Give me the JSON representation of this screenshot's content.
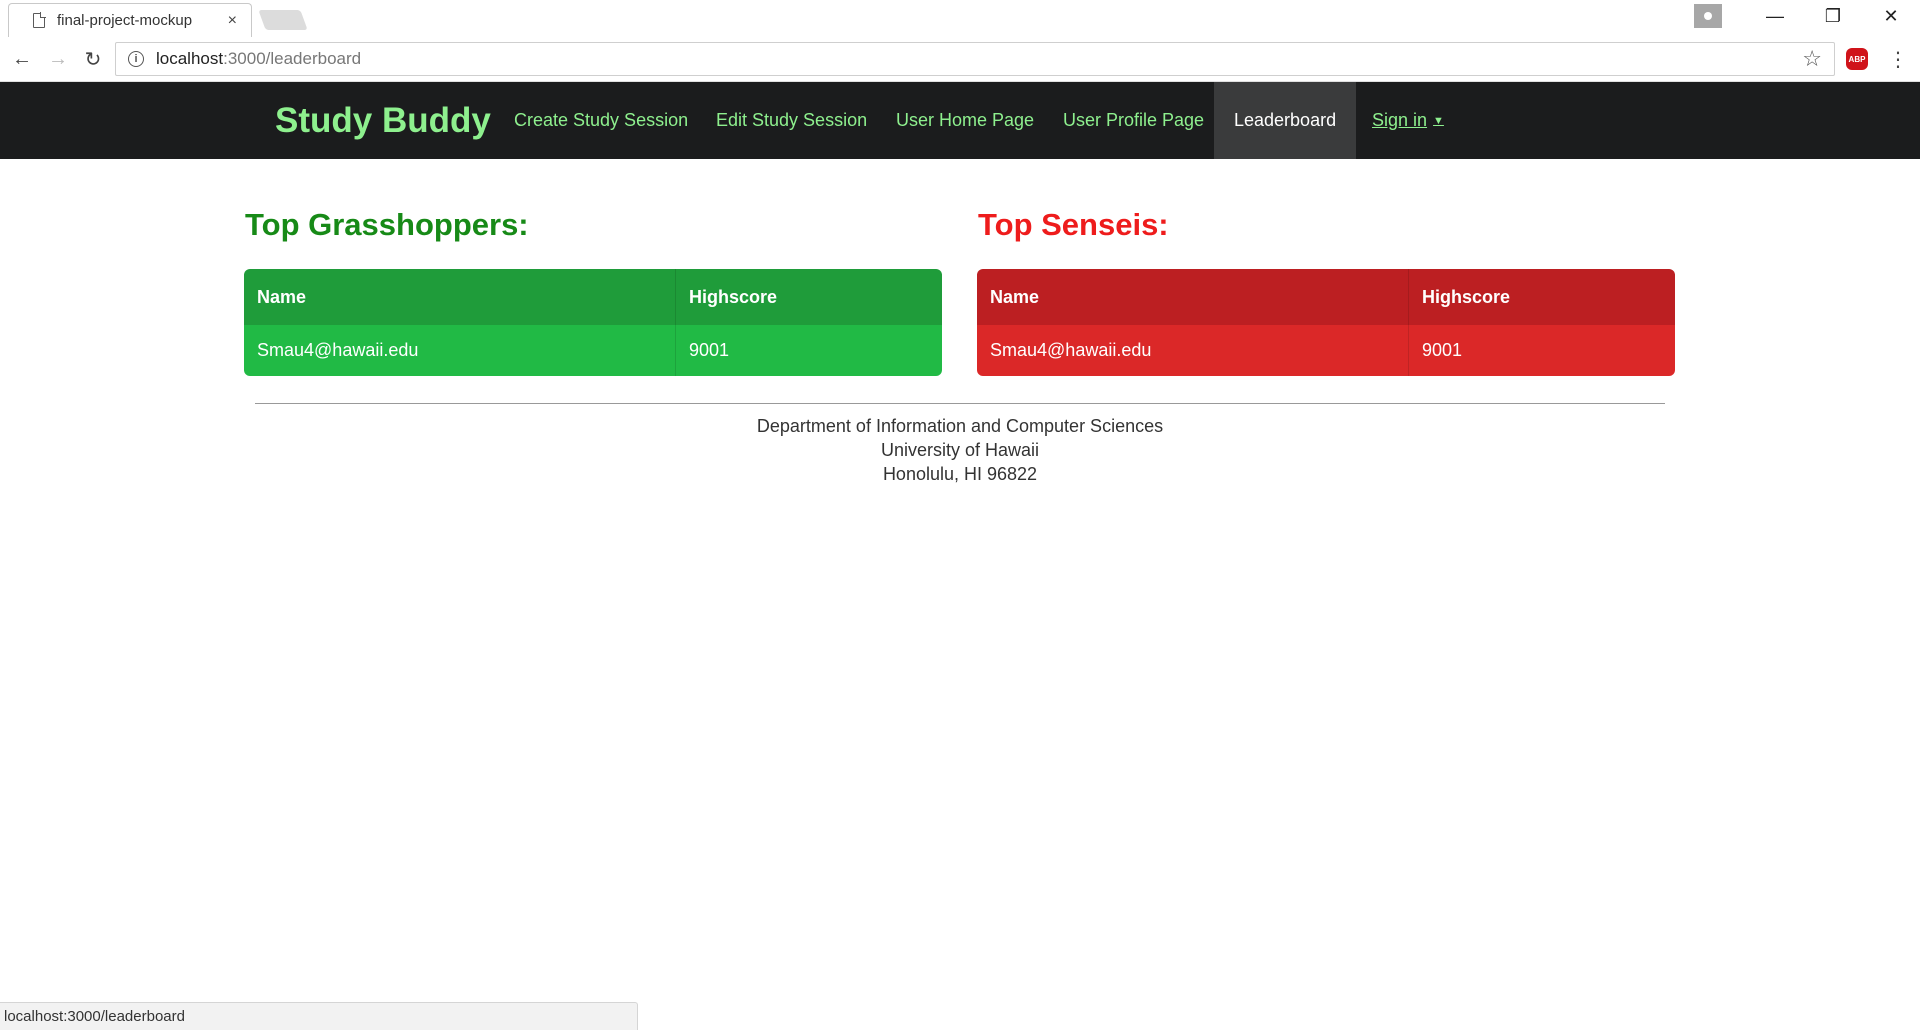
{
  "browser": {
    "tab_title": "final-project-mockup",
    "tab_close": "×",
    "url_host": "localhost",
    "url_path": ":3000/leaderboard",
    "abp_label": "ABP",
    "status_text": "localhost:3000/leaderboard"
  },
  "navbar": {
    "brand": "Study Buddy",
    "items": [
      {
        "label": "Create Study Session"
      },
      {
        "label": "Edit Study Session"
      },
      {
        "label": "User Home Page"
      },
      {
        "label": "User Profile Page"
      },
      {
        "label": "Leaderboard",
        "active": true
      },
      {
        "label": "Sign in",
        "dropdown": true
      }
    ],
    "caret": "▼"
  },
  "grasshoppers": {
    "title": "Top Grasshoppers:",
    "columns": [
      "Name",
      "Highscore"
    ],
    "rows": [
      {
        "name": "Smau4@hawaii.edu",
        "score": "9001"
      }
    ]
  },
  "senseis": {
    "title": "Top Senseis:",
    "columns": [
      "Name",
      "Highscore"
    ],
    "rows": [
      {
        "name": "Smau4@hawaii.edu",
        "score": "9001"
      }
    ]
  },
  "footer": {
    "line1": "Department of Information and Computer Sciences",
    "line2": "University of Hawaii",
    "line3": "Honolulu, HI 96822"
  },
  "colors": {
    "navbar_bg": "#1b1c1d",
    "brand_green": "#8ef08e",
    "green_title": "#178a17",
    "red_title": "#ee1c1c",
    "green_table": "#21ba45",
    "red_table": "#db2828"
  }
}
